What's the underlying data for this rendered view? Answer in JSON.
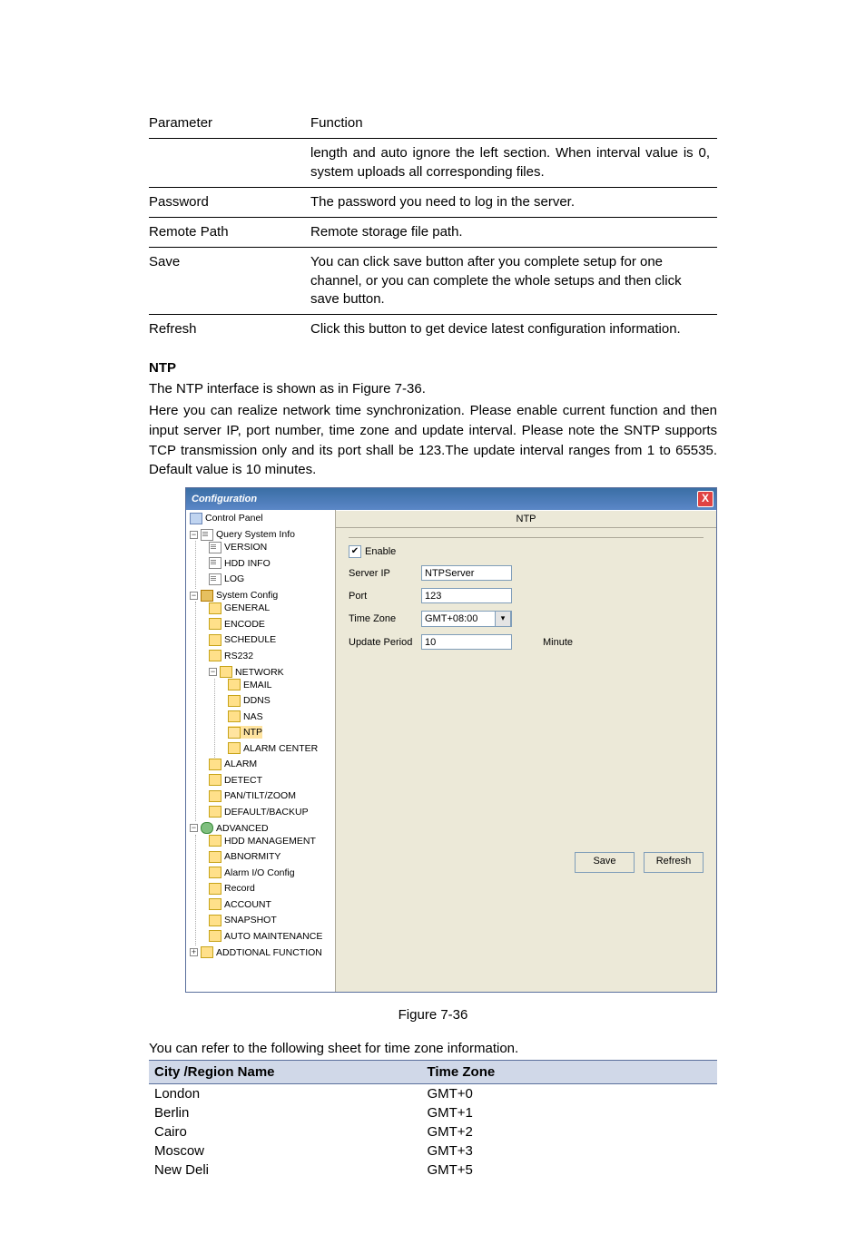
{
  "param_table": {
    "header": {
      "c0": "Parameter",
      "c1": "Function"
    },
    "rows": [
      {
        "param": "",
        "func": "length and auto ignore the left section. When interval value is 0, system uploads all corresponding files."
      },
      {
        "param": "Password",
        "func": "The password you need to log in the server."
      },
      {
        "param": "Remote Path",
        "func": "Remote storage file path."
      },
      {
        "param": "Save",
        "func": "You can click save button after you complete setup for one channel, or you can complete the whole setups and then click save button."
      },
      {
        "param": "Refresh",
        "func": "Click this button to get device latest configuration information."
      }
    ]
  },
  "section_title": "NTP",
  "body": [
    "The NTP interface is shown as in Figure 7-36.",
    "Here you can realize network time synchronization. Please enable current function and then input server IP, port number, time zone and update interval. Please note the SNTP supports TCP transmission only and its port shall be 123.The update interval ranges from 1 to 65535. Default value is 10 minutes."
  ],
  "dialog": {
    "title": "Configuration",
    "close_glyph": "X",
    "panel_title": "NTP",
    "tree": {
      "root": "Control Panel",
      "groups": [
        {
          "label": "Query System Info",
          "items": [
            "VERSION",
            "HDD INFO",
            "LOG"
          ]
        },
        {
          "label": "System Config",
          "items": [
            "GENERAL",
            "ENCODE",
            "SCHEDULE",
            "RS232"
          ],
          "network": {
            "label": "NETWORK",
            "items": [
              "EMAIL",
              "DDNS",
              "NAS",
              "NTP",
              "ALARM CENTER"
            ]
          },
          "items2": [
            "ALARM",
            "DETECT",
            "PAN/TILT/ZOOM",
            "DEFAULT/BACKUP"
          ]
        },
        {
          "label": "ADVANCED",
          "items": [
            "HDD MANAGEMENT",
            "ABNORMITY",
            "Alarm I/O Config",
            "Record",
            "ACCOUNT",
            "SNAPSHOT",
            "AUTO MAINTENANCE"
          ]
        },
        {
          "label": "ADDTIONAL FUNCTION"
        }
      ]
    },
    "form": {
      "enable": {
        "label": "Enable",
        "checked": "✔"
      },
      "server_ip": {
        "label": "Server IP",
        "value": "NTPServer"
      },
      "port": {
        "label": "Port",
        "value": "123"
      },
      "time_zone": {
        "label": "Time Zone",
        "value": "GMT+08:00"
      },
      "update_period": {
        "label": "Update Period",
        "value": "10",
        "unit": "Minute"
      }
    },
    "buttons": {
      "save": "Save",
      "refresh": "Refresh"
    }
  },
  "figure_caption": "Figure 7-36",
  "tz_intro": "You can refer to the following sheet for time zone information.",
  "tz_table": {
    "headers": [
      "City /Region Name",
      "Time Zone"
    ],
    "rows": [
      [
        "London",
        "GMT+0"
      ],
      [
        "Berlin",
        "GMT+1"
      ],
      [
        "Cairo",
        "GMT+2"
      ],
      [
        "Moscow",
        "GMT+3"
      ],
      [
        "New Deli",
        "GMT+5"
      ]
    ]
  }
}
